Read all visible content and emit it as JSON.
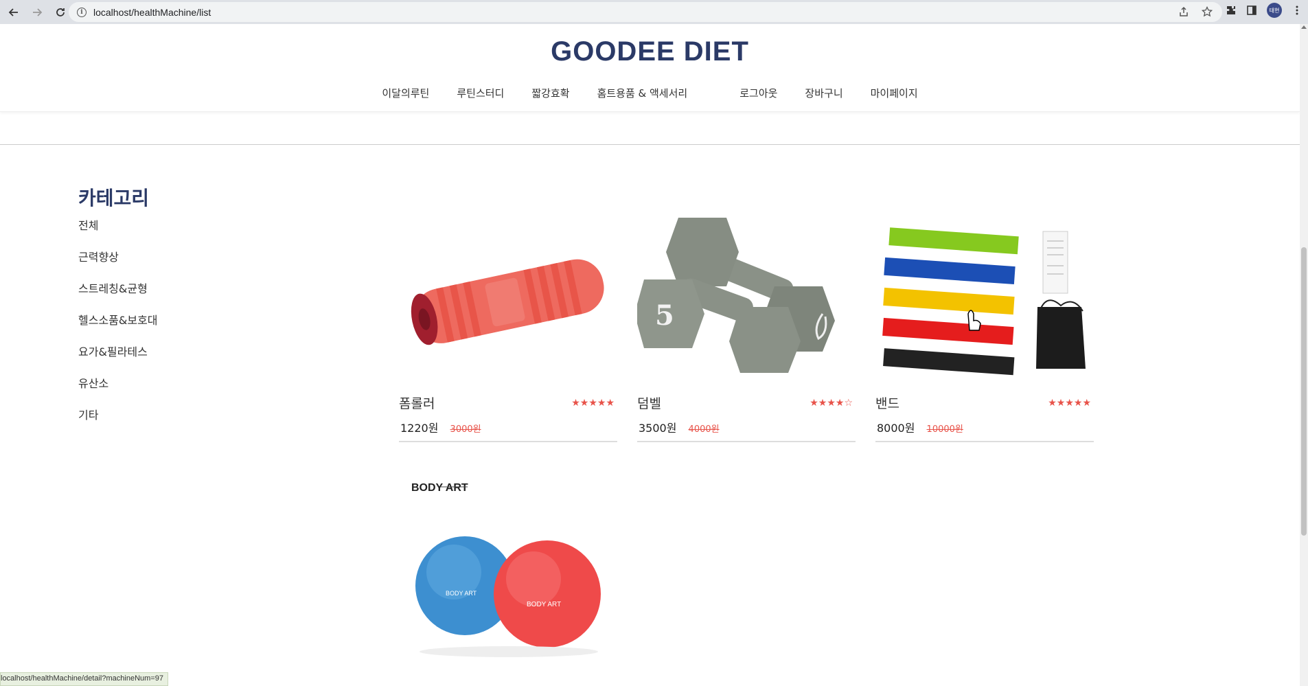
{
  "browser": {
    "url": "localhost/healthMachine/list",
    "avatar_label": "태현"
  },
  "site": {
    "brand": "GOODEE DIET",
    "nav": [
      "이달의루틴",
      "루틴스터디",
      "짧강효확",
      "홈트용품 & 액세서리",
      "로그아웃",
      "장바구니",
      "마이페이지"
    ]
  },
  "sidebar": {
    "title": "카테고리",
    "items": [
      "전체",
      "근력향상",
      "스트레칭&균형",
      "헬스소품&보호대",
      "요가&필라테스",
      "유산소",
      "기타"
    ]
  },
  "products": [
    {
      "name": "폼롤러",
      "price": "1220원",
      "original_price": "3000원",
      "rating": 5,
      "stars": "★★★★★"
    },
    {
      "name": "덤벨",
      "price": "3500원",
      "original_price": "4000원",
      "rating": 4,
      "stars": "★★★★☆"
    },
    {
      "name": "밴드",
      "price": "8000원",
      "original_price": "10000원",
      "rating": 5,
      "stars": "★★★★★"
    },
    {
      "name": "",
      "price": "",
      "original_price": "",
      "brand_text": "BODY ART",
      "ball_text": "BODY ART"
    }
  ],
  "status_bar": "localhost/healthMachine/detail?machineNum=97",
  "colors": {
    "brand": "#2b3a67",
    "accent": "#e8534a"
  }
}
